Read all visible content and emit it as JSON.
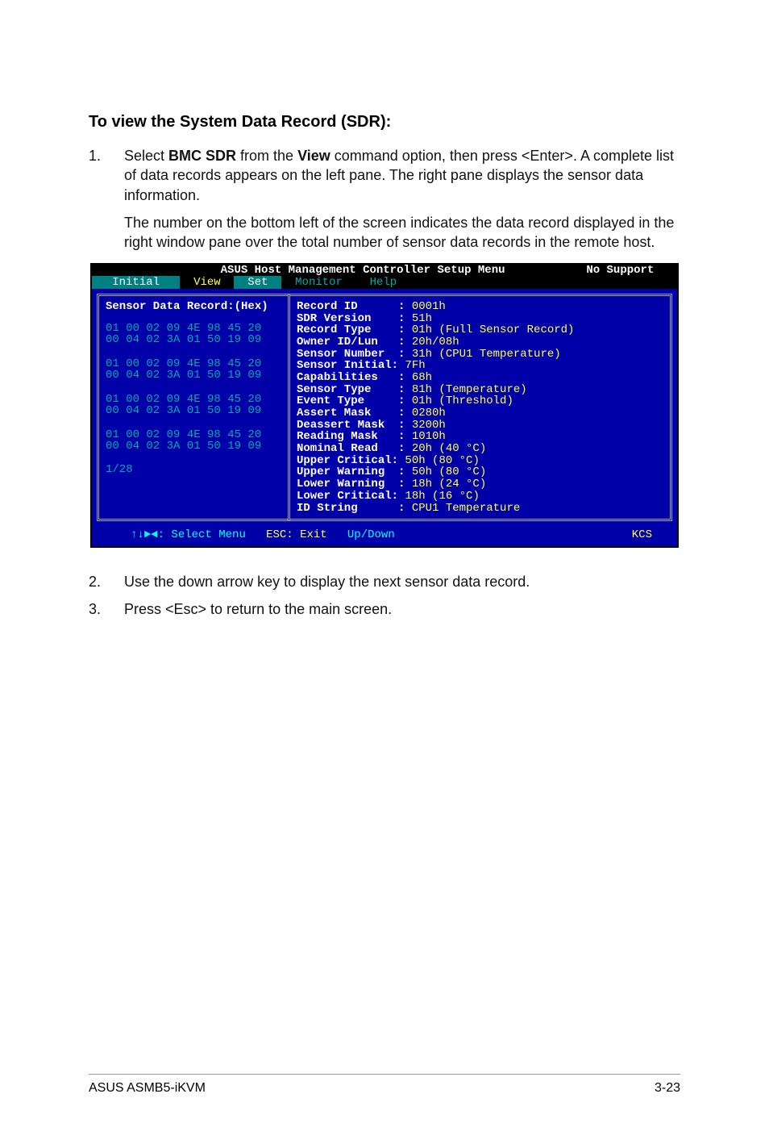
{
  "heading": "To view the System Data Record (SDR):",
  "steps": [
    {
      "num": "1.",
      "paras": [
        {
          "segments": [
            {
              "t": "Select ",
              "b": false
            },
            {
              "t": "BMC SDR",
              "b": true
            },
            {
              "t": " from the ",
              "b": false
            },
            {
              "t": "View",
              "b": true
            },
            {
              "t": " command option, then press <Enter>. A complete list of data records appears on the left pane. The right pane displays the sensor data information.",
              "b": false
            }
          ]
        },
        {
          "segments": [
            {
              "t": "The number on the bottom left of the screen indicates the data record displayed in the right window pane over the total number of sensor data records in the remote host.",
              "b": false
            }
          ]
        }
      ]
    },
    {
      "num": "2.",
      "paras": [
        {
          "segments": [
            {
              "t": "Use the down arrow key to display the next sensor data record.",
              "b": false
            }
          ]
        }
      ]
    },
    {
      "num": "3.",
      "paras": [
        {
          "segments": [
            {
              "t": "Press <Esc> to return to the main screen.",
              "b": false
            }
          ]
        }
      ]
    }
  ],
  "terminal": {
    "title_left": "ASUS Host Management Controller Setup Menu",
    "title_right": "No Support",
    "menu": {
      "initial": "Initial",
      "view": "View",
      "set": "Set",
      "monitor": "Monitor",
      "help": "Help"
    },
    "left_title": "Sensor Data Record:(Hex)",
    "hex_rows": [
      "01 00 02 09 4E 98 45 20",
      "00 04 02 3A 01 50 19 09",
      "",
      "01 00 02 09 4E 98 45 20",
      "00 04 02 3A 01 50 19 09",
      "",
      "01 00 02 09 4E 98 45 20",
      "00 04 02 3A 01 50 19 09",
      "",
      "01 00 02 09 4E 98 45 20",
      "00 04 02 3A 01 50 19 09"
    ],
    "counter": "1/28",
    "kv": [
      {
        "l": "Record ID      :",
        "v": " 0001h"
      },
      {
        "l": "SDR Version    :",
        "v": " 51h"
      },
      {
        "l": "Record Type    :",
        "v": " 01h (Full Sensor Record)"
      },
      {
        "l": "Owner ID/Lun   :",
        "v": " 20h/08h"
      },
      {
        "l": "Sensor Number  :",
        "v": " 31h (CPU1 Temperature)"
      },
      {
        "l": "Sensor Initial:",
        "v": " 7Fh"
      },
      {
        "l": "Capabilities   :",
        "v": " 68h"
      },
      {
        "l": "Sensor Type    :",
        "v": " 81h (Temperature)"
      },
      {
        "l": "Event Type     :",
        "v": " 01h (Threshold)"
      },
      {
        "l": "Assert Mask    :",
        "v": " 0280h"
      },
      {
        "l": "Deassert Mask  :",
        "v": " 3200h"
      },
      {
        "l": "Reading Mask   :",
        "v": " 1010h"
      },
      {
        "l": "Nominal Read   :",
        "v": " 20h (40 °C)"
      },
      {
        "l": "Upper Critical:",
        "v": " 50h (80 °C)"
      },
      {
        "l": "Upper Warning  :",
        "v": " 50h (80 °C)"
      },
      {
        "l": "Lower Warning  :",
        "v": " 18h (24 °C)"
      },
      {
        "l": "Lower Critical:",
        "v": " 18h (16 °C)"
      },
      {
        "l": "ID String      :",
        "v": " CPU1 Temperature"
      }
    ],
    "status": {
      "nav": "↑↓►◄: Select Menu",
      "esc": "ESC: Exit",
      "updown": "Up/Down",
      "kcs": "KCS"
    }
  },
  "footer": {
    "left": "ASUS ASMB5-iKVM",
    "right": "3-23"
  }
}
